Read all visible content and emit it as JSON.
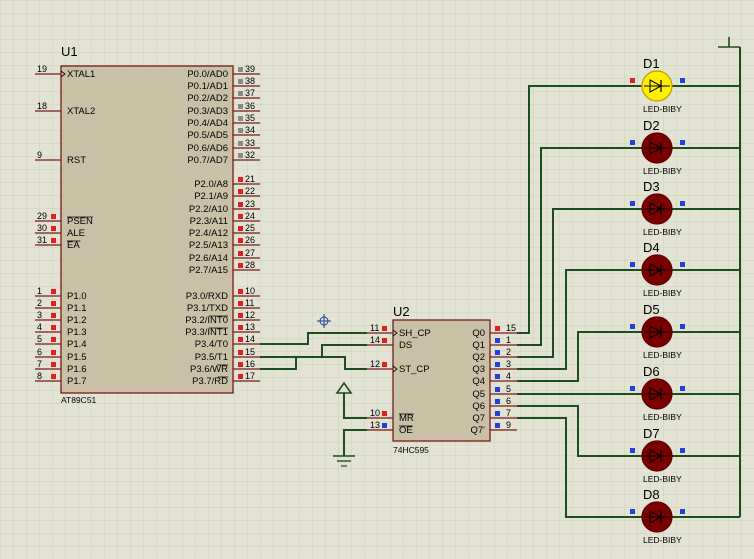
{
  "u1": {
    "ref": "U1",
    "part": "AT89C51",
    "left_pins": [
      {
        "num": "19",
        "name": "XTAL1"
      },
      {
        "num": "18",
        "name": "XTAL2"
      },
      {
        "num": "9",
        "name": "RST"
      },
      {
        "num": "29",
        "name": "PSEN",
        "overline": true
      },
      {
        "num": "30",
        "name": "ALE"
      },
      {
        "num": "31",
        "name": "EA",
        "overline": true
      },
      {
        "num": "1",
        "name": "P1.0"
      },
      {
        "num": "2",
        "name": "P1.1"
      },
      {
        "num": "3",
        "name": "P1.2"
      },
      {
        "num": "4",
        "name": "P1.3"
      },
      {
        "num": "5",
        "name": "P1.4"
      },
      {
        "num": "6",
        "name": "P1.5"
      },
      {
        "num": "7",
        "name": "P1.6"
      },
      {
        "num": "8",
        "name": "P1.7"
      }
    ],
    "right_pins": [
      {
        "num": "39",
        "name": "P0.0/AD0"
      },
      {
        "num": "38",
        "name": "P0.1/AD1"
      },
      {
        "num": "37",
        "name": "P0.2/AD2"
      },
      {
        "num": "36",
        "name": "P0.3/AD3"
      },
      {
        "num": "35",
        "name": "P0.4/AD4"
      },
      {
        "num": "34",
        "name": "P0.5/AD5"
      },
      {
        "num": "33",
        "name": "P0.6/AD6"
      },
      {
        "num": "32",
        "name": "P0.7/AD7"
      },
      {
        "num": "21",
        "name": "P2.0/A8"
      },
      {
        "num": "22",
        "name": "P2.1/A9"
      },
      {
        "num": "23",
        "name": "P2.2/A10"
      },
      {
        "num": "24",
        "name": "P2.3/A11"
      },
      {
        "num": "25",
        "name": "P2.4/A12"
      },
      {
        "num": "26",
        "name": "P2.5/A13"
      },
      {
        "num": "27",
        "name": "P2.6/A14"
      },
      {
        "num": "28",
        "name": "P2.7/A15"
      },
      {
        "num": "10",
        "name": "P3.0/RXD"
      },
      {
        "num": "11",
        "name": "P3.1/TXD"
      },
      {
        "num": "12",
        "name": "P3.2/INT0"
      },
      {
        "num": "13",
        "name": "P3.3/INT1"
      },
      {
        "num": "14",
        "name": "P3.4/T0"
      },
      {
        "num": "15",
        "name": "P3.5/T1"
      },
      {
        "num": "16",
        "name": "P3.6/WR"
      },
      {
        "num": "17",
        "name": "P3.7/RD"
      }
    ]
  },
  "u2": {
    "ref": "U2",
    "part": "74HC595",
    "left_pins": [
      {
        "num": "11",
        "name": "SH_CP"
      },
      {
        "num": "14",
        "name": "DS"
      },
      {
        "num": "12",
        "name": "ST_CP"
      },
      {
        "num": "10",
        "name": "MR",
        "overline": true
      },
      {
        "num": "13",
        "name": "OE",
        "overline": true
      }
    ],
    "right_pins": [
      {
        "num": "15",
        "name": "Q0"
      },
      {
        "num": "1",
        "name": "Q1"
      },
      {
        "num": "2",
        "name": "Q2"
      },
      {
        "num": "3",
        "name": "Q3"
      },
      {
        "num": "4",
        "name": "Q4"
      },
      {
        "num": "5",
        "name": "Q5"
      },
      {
        "num": "6",
        "name": "Q6"
      },
      {
        "num": "7",
        "name": "Q7"
      },
      {
        "num": "9",
        "name": "Q7'"
      }
    ]
  },
  "leds": [
    {
      "ref": "D1",
      "part": "LED-BIBY",
      "lit": true
    },
    {
      "ref": "D2",
      "part": "LED-BIBY",
      "lit": false
    },
    {
      "ref": "D3",
      "part": "LED-BIBY",
      "lit": false
    },
    {
      "ref": "D4",
      "part": "LED-BIBY",
      "lit": false
    },
    {
      "ref": "D5",
      "part": "LED-BIBY",
      "lit": false
    },
    {
      "ref": "D6",
      "part": "LED-BIBY",
      "lit": false
    },
    {
      "ref": "D7",
      "part": "LED-BIBY",
      "lit": false
    },
    {
      "ref": "D8",
      "part": "LED-BIBY",
      "lit": false
    }
  ],
  "colors": {
    "background": "#e3e3d3",
    "grid": "#cfcfbd",
    "wire": "#1e4d1e",
    "body": "#c9c1a6",
    "outline": "#7a1a1a",
    "pin_high": "#e02020",
    "pin_low": "#2040e0",
    "pin_float": "#8a8a8a",
    "led_on": "#ffee00",
    "led_off": "#7a0000"
  }
}
